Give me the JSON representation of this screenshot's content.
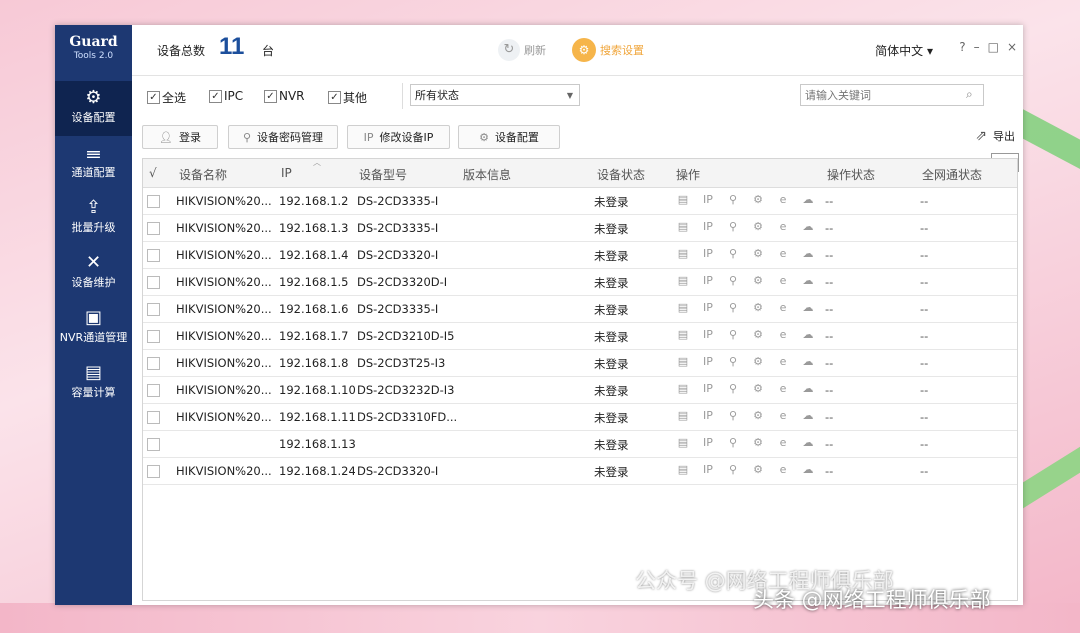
{
  "app": {
    "logo_line1": "Guard",
    "logo_line2": "Tools 2.0"
  },
  "sidebar": {
    "items": [
      {
        "label": "设备配置",
        "icon": "gear-icon",
        "glyph": "⚙",
        "active": true
      },
      {
        "label": "通道配置",
        "icon": "sliders-icon",
        "glyph": "𝍢"
      },
      {
        "label": "批量升级",
        "icon": "upgrade-icon",
        "glyph": "⇪"
      },
      {
        "label": "设备维护",
        "icon": "tools-icon",
        "glyph": "✕"
      },
      {
        "label": "NVR通道管理",
        "icon": "nvr-icon",
        "glyph": "▣"
      },
      {
        "label": "容量计算",
        "icon": "calculator-icon",
        "glyph": "▤"
      }
    ]
  },
  "header": {
    "count_label": "设备总数",
    "count_value": "11",
    "count_unit": "台",
    "refresh_label": "刷新",
    "search_settings_label": "搜索设置",
    "language": "简体中文"
  },
  "filters": {
    "checkboxes": [
      {
        "label": "全选",
        "checked": true
      },
      {
        "label": "IPC",
        "checked": true
      },
      {
        "label": "NVR",
        "checked": true
      },
      {
        "label": "其他",
        "checked": true
      }
    ],
    "status_select": "所有状态",
    "search_placeholder": "请输入关键词"
  },
  "actions": {
    "login": "登录",
    "password_mgmt": "设备密码管理",
    "modify_ip": "修改设备IP",
    "device_config": "设备配置",
    "export": "导出",
    "tooltip": "导出"
  },
  "table": {
    "headers": {
      "check": "√",
      "name": "设备名称",
      "ip": "IP",
      "model": "设备型号",
      "version": "版本信息",
      "status": "设备状态",
      "ops": "操作",
      "op_state": "操作状态",
      "net_state": "全网通状态"
    },
    "rows": [
      {
        "name": "HIKVISION%20...",
        "ip": "192.168.1.2",
        "model": "DS-2CD3335-I",
        "status": "未登录",
        "op_state": "--",
        "net_state": "--"
      },
      {
        "name": "HIKVISION%20...",
        "ip": "192.168.1.3",
        "model": "DS-2CD3335-I",
        "status": "未登录",
        "op_state": "--",
        "net_state": "--"
      },
      {
        "name": "HIKVISION%20...",
        "ip": "192.168.1.4",
        "model": "DS-2CD3320-I",
        "status": "未登录",
        "op_state": "--",
        "net_state": "--"
      },
      {
        "name": "HIKVISION%20...",
        "ip": "192.168.1.5",
        "model": "DS-2CD3320D-I",
        "status": "未登录",
        "op_state": "--",
        "net_state": "--"
      },
      {
        "name": "HIKVISION%20...",
        "ip": "192.168.1.6",
        "model": "DS-2CD3335-I",
        "status": "未登录",
        "op_state": "--",
        "net_state": "--"
      },
      {
        "name": "HIKVISION%20...",
        "ip": "192.168.1.7",
        "model": "DS-2CD3210D-I5",
        "status": "未登录",
        "op_state": "--",
        "net_state": "--"
      },
      {
        "name": "HIKVISION%20...",
        "ip": "192.168.1.8",
        "model": "DS-2CD3T25-I3",
        "status": "未登录",
        "op_state": "--",
        "net_state": "--"
      },
      {
        "name": "HIKVISION%20...",
        "ip": "192.168.1.10",
        "model": "DS-2CD3232D-I3",
        "status": "未登录",
        "op_state": "--",
        "net_state": "--"
      },
      {
        "name": "HIKVISION%20...",
        "ip": "192.168.1.11",
        "model": "DS-2CD3310FD...",
        "status": "未登录",
        "op_state": "--",
        "net_state": "--"
      },
      {
        "name": "",
        "ip": "192.168.1.13",
        "model": "",
        "status": "未登录",
        "op_state": "--",
        "net_state": "--"
      },
      {
        "name": "HIKVISION%20...",
        "ip": "192.168.1.24",
        "model": "DS-2CD3320-I",
        "status": "未登录",
        "op_state": "--",
        "net_state": "--"
      }
    ],
    "op_icons": [
      {
        "icon": "document-icon",
        "glyph": "▤"
      },
      {
        "icon": "ip-icon",
        "glyph": "IP"
      },
      {
        "icon": "key-icon",
        "glyph": "⚲"
      },
      {
        "icon": "settings-icon",
        "glyph": "⚙"
      },
      {
        "icon": "browser-icon",
        "glyph": "e"
      },
      {
        "icon": "cloud-icon",
        "glyph": "☁"
      }
    ]
  },
  "watermark": {
    "line1": "公众号 @网络工程师俱乐部",
    "line2": "头条 @网络工程师俱乐部"
  },
  "colors": {
    "sidebar": "#1d3872",
    "sidebar_active": "#0f2450",
    "count": "#1c4f9c",
    "search_settings": "#f6b54a"
  }
}
